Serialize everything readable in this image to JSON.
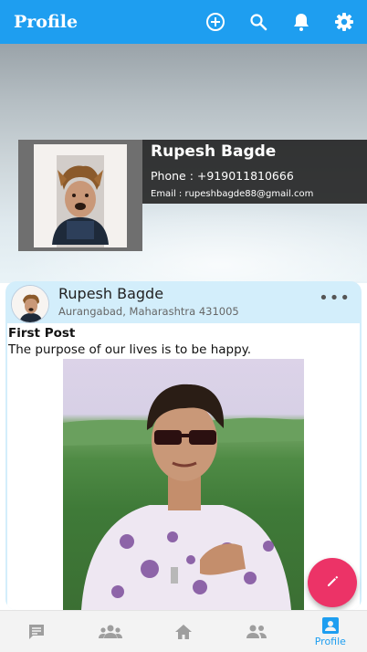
{
  "app_bar": {
    "title": "Profile",
    "icons": [
      "add-circle-icon",
      "search-icon",
      "bell-icon",
      "gear-icon"
    ],
    "background": "#1e9ef0"
  },
  "profile": {
    "name": "Rupesh Bagde",
    "phone": "Phone : +919011810666",
    "email": "Email : rupeshbagde88@gmail.com"
  },
  "post": {
    "author": "Rupesh Bagde",
    "location": "Aurangabad, Maharashtra 431005",
    "more_label": "•••",
    "title": "First Post",
    "text": "The purpose of our lives is to be happy."
  },
  "fab": {
    "icon": "pencil-icon",
    "color": "#ec3367"
  },
  "bottom_nav": {
    "items": [
      {
        "icon": "chat-icon",
        "label": ""
      },
      {
        "icon": "groups-icon",
        "label": ""
      },
      {
        "icon": "home-icon",
        "label": ""
      },
      {
        "icon": "people-icon",
        "label": ""
      },
      {
        "icon": "profile-icon",
        "label": "Profile"
      }
    ],
    "active_color": "#1e9ef0",
    "inactive_color": "#9e9e9e"
  }
}
